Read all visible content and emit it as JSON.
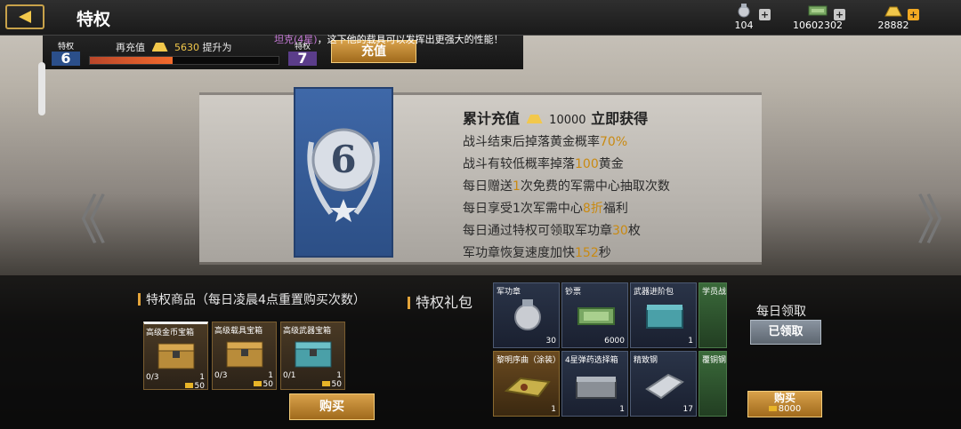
{
  "header": {
    "title": "特权",
    "resources": [
      {
        "name": "medal",
        "icon": "medal-icon",
        "value": "104"
      },
      {
        "name": "cash",
        "icon": "money-icon",
        "value": "10602302"
      },
      {
        "name": "gold",
        "icon": "gold-bar-icon",
        "value": "28882"
      }
    ]
  },
  "vip": {
    "current_label": "特权",
    "current_level": "6",
    "next_label": "特权",
    "next_level": "7",
    "recharge_text": "再充值",
    "recharge_amount": "5630",
    "upgrade_text": "提升为",
    "progress_fraction": 0.44,
    "recharge_button": "充值"
  },
  "notice": {
    "highlight": "坦克(4星)",
    "text": "，这下他的载具可以发挥出更强大的性能！"
  },
  "card": {
    "level_number": "6",
    "heading": "累计充值",
    "heading_amount": "10000",
    "heading_suffix": "立即获得",
    "benefits": [
      {
        "pre": "战斗结束后掉落黄金概率",
        "hl": "70%",
        "post": ""
      },
      {
        "pre": "战斗有较低概率掉落",
        "hl": "100",
        "post": "黄金"
      },
      {
        "pre": "每日赠送",
        "hl": "1",
        "post": "次免费的军需中心抽取次数"
      },
      {
        "pre": "每日享受1次军需中心",
        "hl": "8折",
        "post": "福利"
      },
      {
        "pre": "每日通过特权可领取军功章",
        "hl": "30",
        "post": "枚"
      },
      {
        "pre": "军功章恢复速度加快",
        "hl": "152",
        "post": "秒"
      }
    ]
  },
  "shop": {
    "title": "特权商品（每日凌晨4点重置购买次数）",
    "items": [
      {
        "name": "高级金币宝箱",
        "count": "0/3",
        "qty": "1",
        "price": "50"
      },
      {
        "name": "高级载具宝箱",
        "count": "0/3",
        "qty": "1",
        "price": "50"
      },
      {
        "name": "高级武器宝箱",
        "count": "0/1",
        "qty": "1",
        "price": "50"
      }
    ],
    "buy_button": "购买"
  },
  "gift": {
    "title": "特权礼包",
    "items": [
      {
        "name": "军功章",
        "qty": "30"
      },
      {
        "name": "钞票",
        "qty": "6000"
      },
      {
        "name": "武器进阶包",
        "qty": "1"
      },
      {
        "name": "学员战",
        "qty": ""
      },
      {
        "name": "黎明序曲（涂装）",
        "qty": "1"
      },
      {
        "name": "4星弹药选择箱",
        "qty": "1"
      },
      {
        "name": "精致钢",
        "qty": "17"
      },
      {
        "name": "覆铜钢",
        "qty": ""
      }
    ],
    "daily_label": "每日领取",
    "claimed_button": "已领取",
    "buy_button": "购买",
    "buy_price": "8000"
  },
  "colors": {
    "accent_gold": "#f2c84b",
    "highlight_yellow": "#c98a12",
    "banner_blue": "#3f68a8"
  }
}
